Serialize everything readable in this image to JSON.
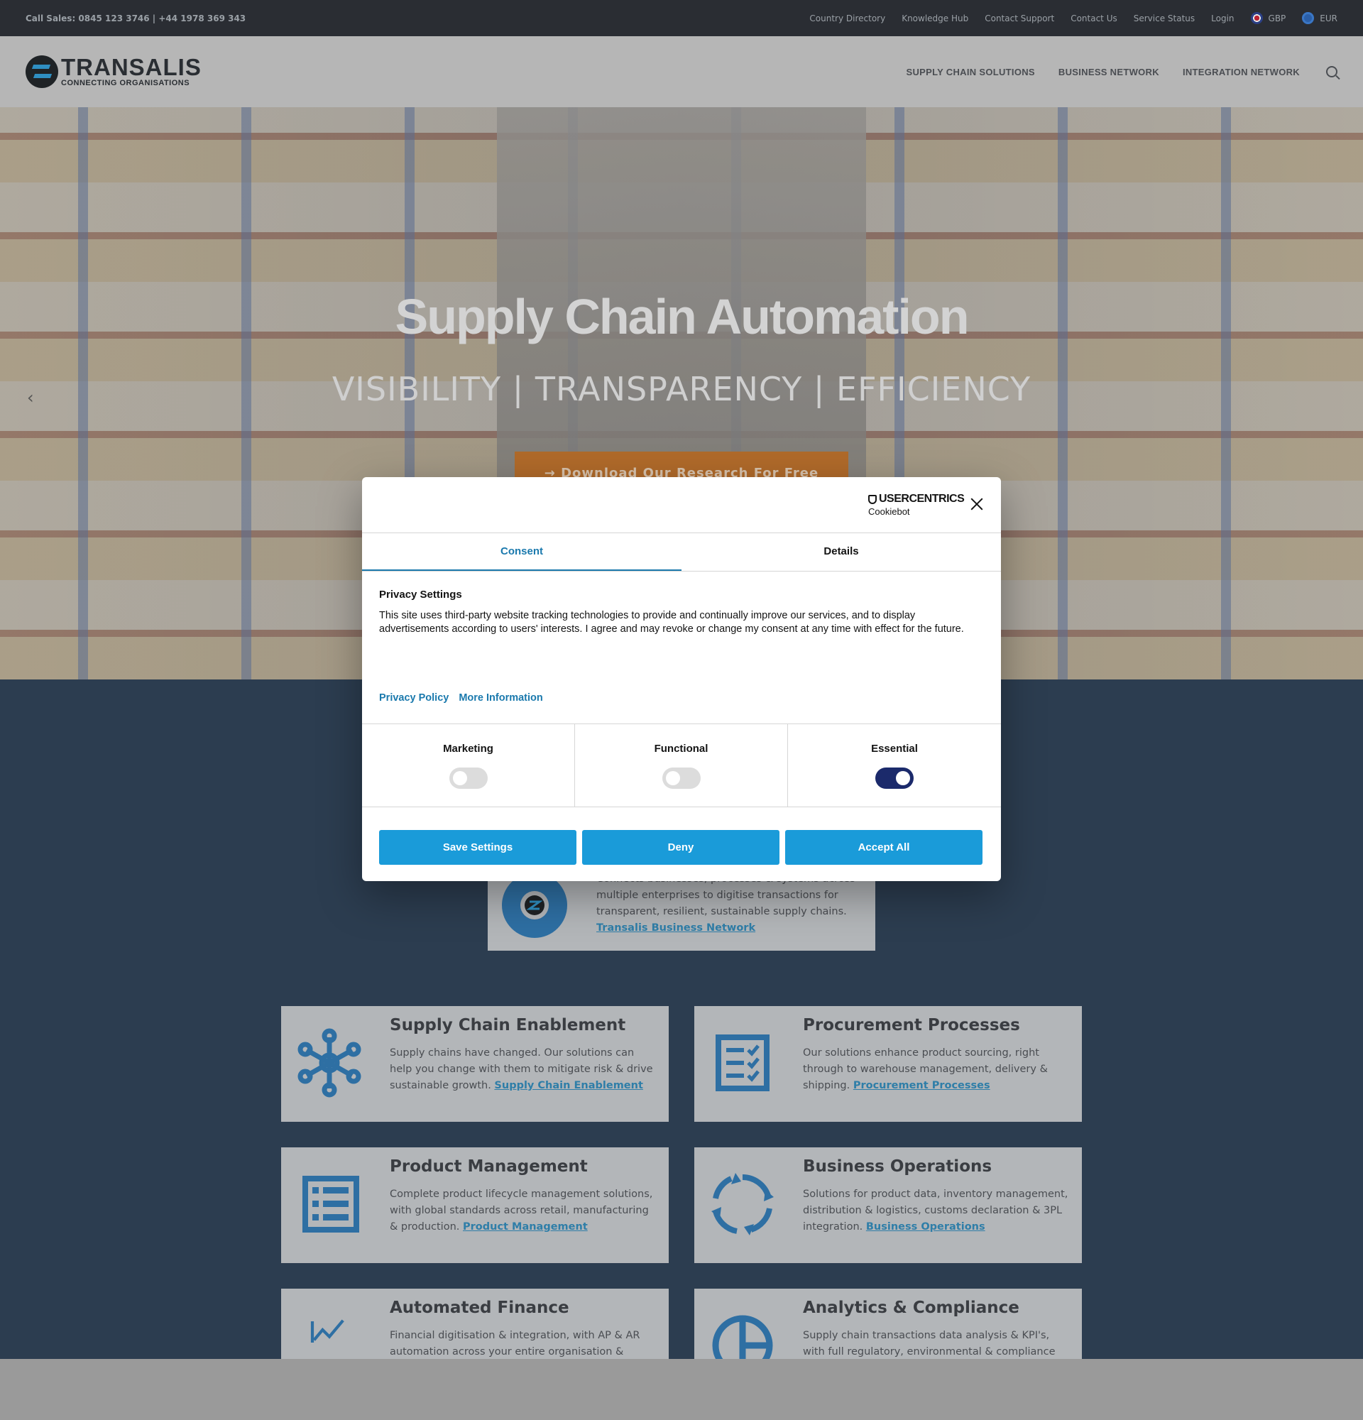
{
  "topbar": {
    "sales": "Call Sales: 0845 123 3746 | +44 1978 369 343",
    "links": [
      "Country Directory",
      "Knowledge Hub",
      "Contact Support",
      "Contact Us",
      "Service Status",
      "Login"
    ],
    "currency_gbp": "GBP",
    "currency_eur": "EUR"
  },
  "header": {
    "logo_word": "TRANSALIS",
    "logo_sub": "CONNECTING ORGANISATIONS",
    "nav": [
      "SUPPLY CHAIN SOLUTIONS",
      "BUSINESS NETWORK",
      "INTEGRATION NETWORK"
    ]
  },
  "hero": {
    "title": "Supply Chain Automation",
    "subtitle": "VISIBILITY | TRANSPARENCY | EFFICIENCY",
    "cta": "→ Download Our Research For Free",
    "prev": "‹"
  },
  "business_network_card": {
    "text": "Connects businesses, processes & systems across multiple enterprises to digitise transactions for transparent, resilient, sustainable supply chains.",
    "link": "Transalis Business Network"
  },
  "cards": [
    {
      "title": "Supply Chain Enablement",
      "text": "Supply chains have changed. Our solutions can help you change with them to mitigate risk & drive sustainable growth.",
      "link": "Supply Chain Enablement",
      "icon": "network-nodes-icon"
    },
    {
      "title": "Procurement Processes",
      "text": "Our solutions enhance product sourcing, right through to warehouse management, delivery & shipping.",
      "link": "Procurement Processes",
      "icon": "checklist-icon"
    },
    {
      "title": "Product Management",
      "text": "Complete product lifecycle management solutions, with global standards across retail, manufacturing & production.",
      "link": "Product Management",
      "icon": "list-icon"
    },
    {
      "title": "Business Operations",
      "text": "Solutions for product data, inventory management, distribution & logistics, customs declaration & 3PL integration.",
      "link": "Business Operations",
      "icon": "cycle-arrows-icon"
    },
    {
      "title": "Automated Finance",
      "text": "Financial digitisation & integration, with AP & AR automation across your entire organisation &",
      "link": "",
      "icon": "line-chart-icon"
    },
    {
      "title": "Analytics & Compliance",
      "text": "Supply chain transactions data analysis & KPI's, with full regulatory, environmental & compliance",
      "link": "",
      "icon": "pie-chart-icon"
    }
  ],
  "cookie": {
    "brand_top": "USERCENTRICS",
    "brand_bottom": "Cookiebot",
    "tab_consent": "Consent",
    "tab_details": "Details",
    "heading": "Privacy Settings",
    "body": "This site uses third-party website tracking technologies to provide and continually improve our services, and to display advertisements according to users' interests. I agree and may revoke or change my consent at any time with effect for the future.",
    "link_privacy": "Privacy Policy",
    "link_more": "More Information",
    "toggle_marketing": "Marketing",
    "toggle_functional": "Functional",
    "toggle_essential": "Essential",
    "btn_save": "Save Settings",
    "btn_deny": "Deny",
    "btn_accept": "Accept All"
  },
  "colors": {
    "accent_blue": "#1a9bd9",
    "link_blue": "#1a79ad",
    "essential_on": "#1b2a6b"
  }
}
